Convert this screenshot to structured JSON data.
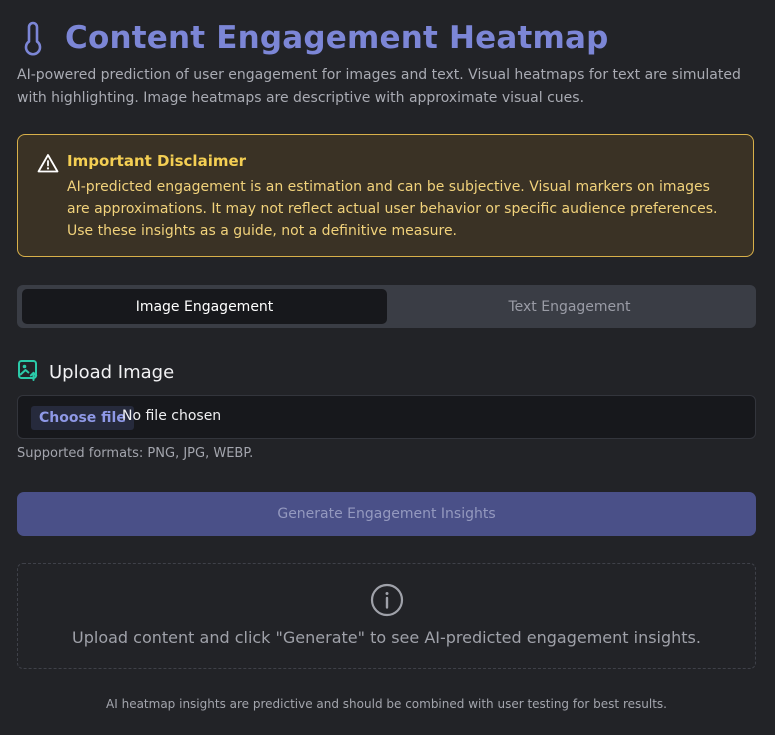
{
  "header": {
    "title": "Content Engagement Heatmap",
    "subtitle": "AI-powered prediction of user engagement for images and text. Visual heatmaps for text are simulated with highlighting. Image heatmaps are descriptive with approximate visual cues.",
    "icon": "thermometer-icon"
  },
  "disclaimer": {
    "title": "Important Disclaimer",
    "body": "AI-predicted engagement is an estimation and can be subjective. Visual markers on images are approximations. It may not reflect actual user behavior or specific audience preferences. Use these insights as a guide, not a definitive measure.",
    "icon": "warning-icon"
  },
  "tabs": [
    {
      "label": "Image Engagement",
      "active": true
    },
    {
      "label": "Text Engagement",
      "active": false
    }
  ],
  "upload": {
    "label": "Upload Image",
    "icon": "image-upload-icon",
    "choose_label": "Choose file",
    "status": "No file chosen",
    "formats": "Supported formats: PNG, JPG, WEBP."
  },
  "generate_label": "Generate Engagement Insights",
  "placeholder": {
    "icon": "info-icon",
    "text": "Upload content and click \"Generate\" to see AI-predicted engagement insights."
  },
  "footer": "AI heatmap insights are predictive and should be combined with user testing for best results.",
  "colors": {
    "accent": "#7c86d6",
    "background": "#222327",
    "warning_border": "#d8b04a",
    "warning_bg": "#3a3225",
    "button": "#4a5088",
    "upload_icon": "#2bc9a8"
  }
}
